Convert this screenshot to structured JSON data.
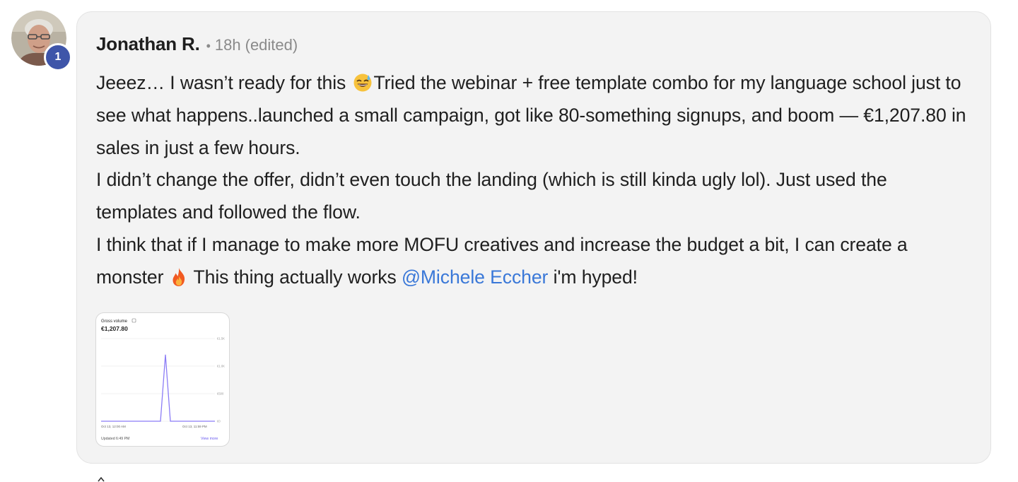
{
  "post": {
    "author": "Jonathan R.",
    "separator": "•",
    "timestamp": "18h",
    "edited_label": "(edited)",
    "avatar_level": "1",
    "paragraph1_a": "Jeeez… I wasn’t ready for this",
    "paragraph1_b": "Tried the webinar + free template combo for my language school just to see what happens..launched a small campaign, got like 80-something signups, and boom — €1,207.80 in sales in just a few hours.",
    "paragraph2": "I didn’t change the offer, didn’t even touch the landing (which is still kinda ugly lol). Just used the templates and followed the flow.",
    "paragraph3_a": "I think that if I manage to make more MOFU creatives and increase the budget a bit, I can create a monster",
    "paragraph3_b": "This thing actually works",
    "mention": "@Michele Eccher",
    "paragraph3_c": "i'm hyped!",
    "emojis": [
      "grinning-sweat-emoji",
      "fire-emoji"
    ]
  },
  "attachment": {
    "card_title": "Gross volume",
    "amount": "€1,207.80",
    "y_tick_labels": [
      "€1.5K",
      "€1.0K",
      "€500",
      "€0"
    ],
    "x_start_label": "Oct 13, 12:00 AM",
    "x_end_label": "Oct 13, 11:59 PM",
    "updated_label": "Updated 6:49 PM",
    "view_more_label": "View more"
  },
  "chart_data": {
    "type": "line",
    "title": "Gross volume",
    "series": [
      {
        "values": [
          0,
          0,
          0,
          0,
          0,
          0,
          0,
          0,
          0,
          0,
          0,
          0,
          0,
          1207.8,
          0,
          0,
          0,
          0,
          0,
          0,
          0,
          0,
          0,
          0
        ]
      }
    ],
    "ylim": [
      0,
      1500
    ],
    "grid": true,
    "line_color": "#8b7cf6"
  },
  "colors": {
    "bubble_bg": "#f3f3f3",
    "text": "#202020",
    "mention": "#3a78d8",
    "badge": "#3e55a9",
    "meta": "#8a8a8a"
  }
}
